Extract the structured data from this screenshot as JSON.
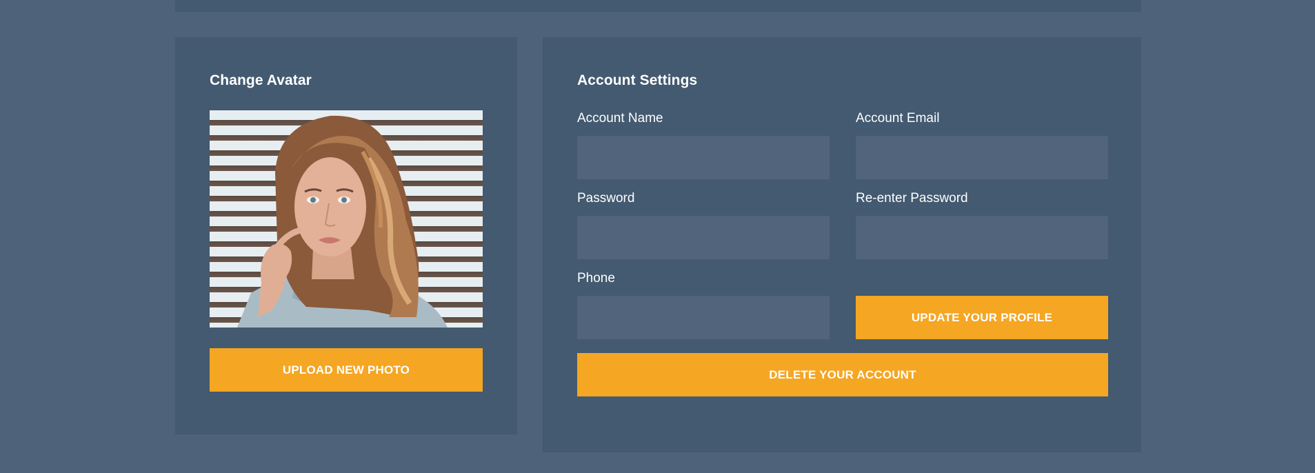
{
  "avatar": {
    "title": "Change Avatar",
    "upload_label": "UPLOAD NEW PHOTO"
  },
  "settings": {
    "title": "Account Settings",
    "fields": {
      "account_name": {
        "label": "Account Name",
        "value": "",
        "placeholder": ""
      },
      "account_email": {
        "label": "Account Email",
        "value": "",
        "placeholder": ""
      },
      "password": {
        "label": "Password",
        "value": "",
        "placeholder": ""
      },
      "reenter_password": {
        "label": "Re-enter Password",
        "value": "",
        "placeholder": ""
      },
      "phone": {
        "label": "Phone",
        "value": "",
        "placeholder": ""
      }
    },
    "update_label": "UPDATE YOUR PROFILE",
    "delete_label": "DELETE YOUR ACCOUNT"
  },
  "colors": {
    "background": "#4e6279",
    "panel": "#435a70",
    "input": "#52647b",
    "accent": "#f5a623"
  }
}
